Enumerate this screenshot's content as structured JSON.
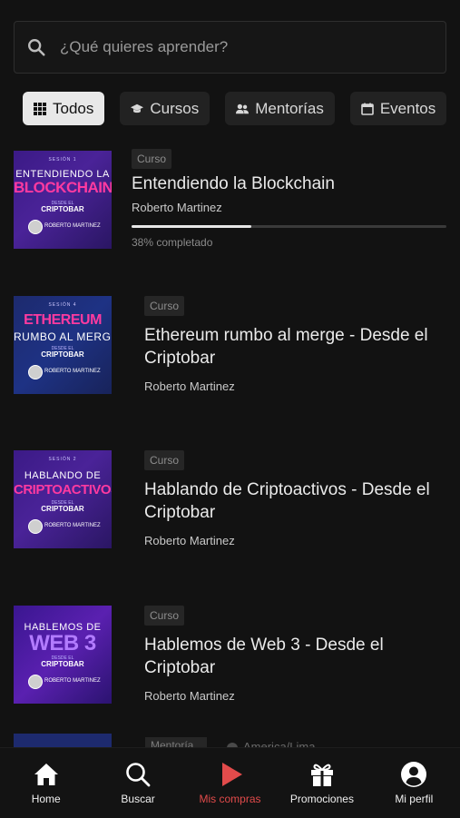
{
  "search": {
    "placeholder": "¿Qué quieres aprender?"
  },
  "filters": [
    {
      "label": "Todos",
      "icon": "grid-icon",
      "active": true
    },
    {
      "label": "Cursos",
      "icon": "graduation-cap-icon",
      "active": false
    },
    {
      "label": "Mentorías",
      "icon": "users-icon",
      "active": false
    },
    {
      "label": "Eventos",
      "icon": "calendar-icon",
      "active": false
    }
  ],
  "items": [
    {
      "type": "Curso",
      "title": "Entendiendo la Blockchain",
      "author": "Roberto Martinez",
      "progress_percent": 38,
      "progress_text": "38% completado",
      "thumb": {
        "session": "SESIÓN 1",
        "line1": "ENTENDIENDO LA",
        "line2": "BLOCKCHAIN",
        "bar_label": "DESDE EL",
        "bar_name": "CRIPTOBAR",
        "host": "ROBERTO MARTINEZ"
      }
    },
    {
      "type": "Curso",
      "title": "Ethereum rumbo al merge - Desde el Criptobar",
      "author": "Roberto Martinez",
      "thumb": {
        "session": "SESIÓN 4",
        "line1": "ETHEREUM",
        "line2": "RUMBO AL MERGE",
        "bar_label": "DESDE EL",
        "bar_name": "CRIPTOBAR",
        "host": "ROBERTO MARTINEZ"
      }
    },
    {
      "type": "Curso",
      "title": "Hablando de Criptoactivos - Desde el Criptobar",
      "author": "Roberto Martinez",
      "thumb": {
        "session": "SESIÓN 2",
        "line1": "HABLANDO DE",
        "line2": "CRIPTOACTIVOS",
        "bar_label": "DESDE EL",
        "bar_name": "CRIPTOBAR",
        "host": "ROBERTO MARTINEZ"
      }
    },
    {
      "type": "Curso",
      "title": "Hablemos de Web 3 - Desde el Criptobar",
      "author": "Roberto Martinez",
      "thumb": {
        "session": "",
        "line1": "HABLEMOS DE",
        "line2": "WEB 3",
        "bar_label": "DESDE EL",
        "bar_name": "CRIPTOBAR",
        "host": "ROBERTO MARTINEZ"
      }
    }
  ],
  "partial_item": {
    "type": "Mentoría",
    "location": "America/Lima"
  },
  "nav": [
    {
      "label": "Home",
      "icon": "home-icon",
      "active": false
    },
    {
      "label": "Buscar",
      "icon": "search-icon",
      "active": false
    },
    {
      "label": "Mis compras",
      "icon": "play-icon",
      "active": true
    },
    {
      "label": "Promociones",
      "icon": "gift-icon",
      "active": false
    },
    {
      "label": "Mi perfil",
      "icon": "profile-icon",
      "active": false
    }
  ],
  "colors": {
    "accent": "#e24b4b",
    "background": "#121212",
    "chip_active": "#e8e8e8"
  }
}
